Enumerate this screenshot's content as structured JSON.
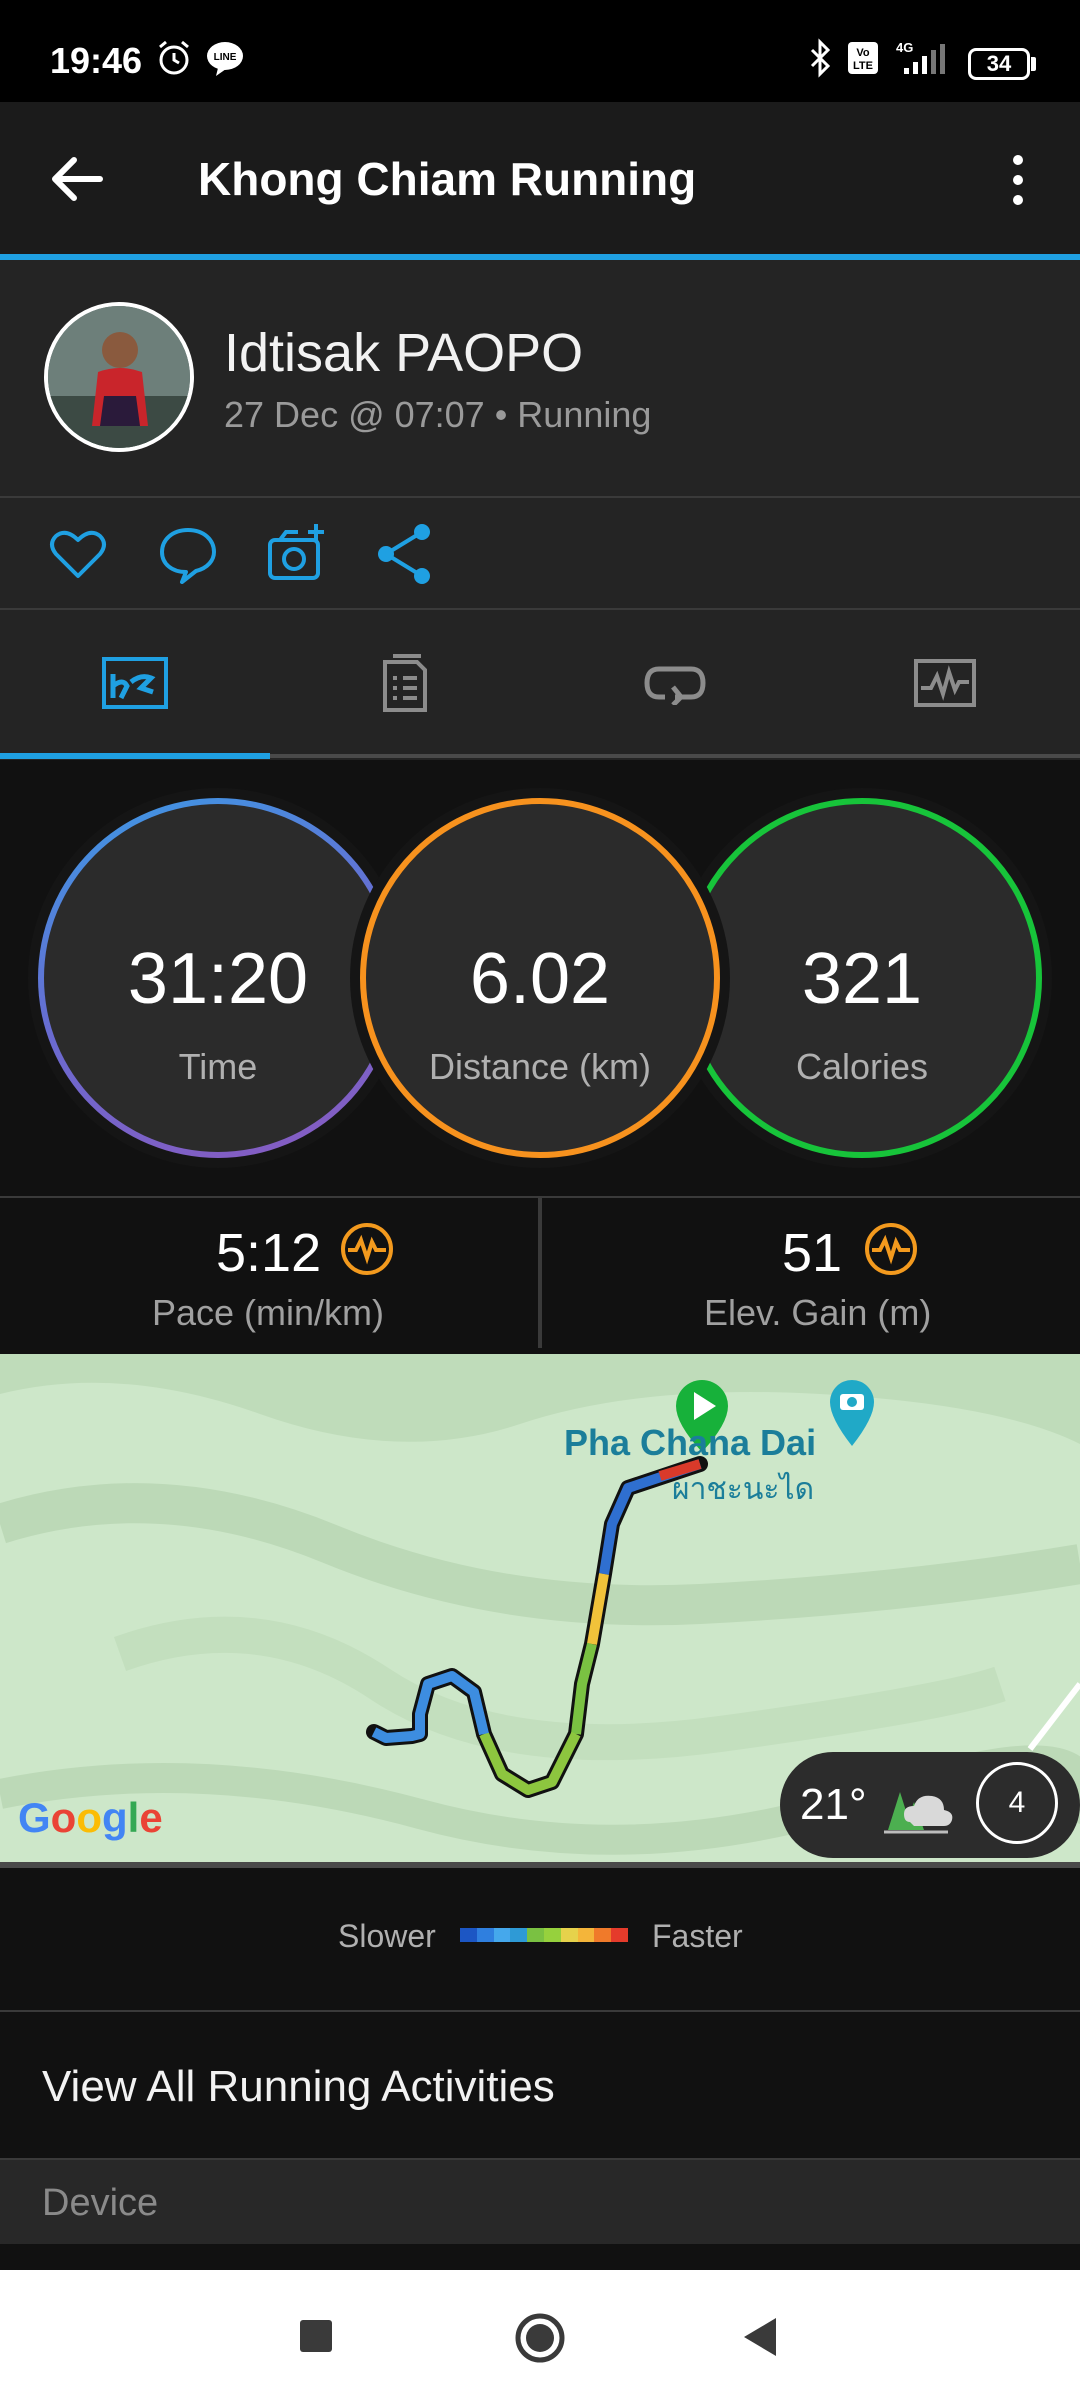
{
  "status_bar": {
    "time": "19:46",
    "battery": "34",
    "network": "4G",
    "icons": [
      "alarm-icon",
      "line-app-icon",
      "bluetooth-icon",
      "volte-icon",
      "signal-icon",
      "battery-icon"
    ]
  },
  "app_bar": {
    "title": "Khong Chiam Running",
    "icons": [
      "back-arrow-icon",
      "more-vert-icon"
    ]
  },
  "profile": {
    "name": "Idtisak PAOPO",
    "meta": "27 Dec @ 07:07 • Running"
  },
  "actions": [
    "like-icon",
    "comment-icon",
    "add-photo-icon",
    "share-icon"
  ],
  "tabs": [
    "overview-tab-icon",
    "details-tab-icon",
    "laps-tab-icon",
    "charts-tab-icon"
  ],
  "stats": {
    "time": {
      "value": "31:20",
      "label": "Time"
    },
    "distance": {
      "value": "6.02",
      "label": "Distance (km)"
    },
    "calories": {
      "value": "321",
      "label": "Calories"
    }
  },
  "metrics": {
    "pace": {
      "value": "5:12",
      "label": "Pace (min/km)"
    },
    "elevation": {
      "value": "51",
      "label": "Elev. Gain (m)"
    }
  },
  "map": {
    "poi_name": "Pha Chana Dai",
    "poi_thai": "ผาชะนะได",
    "provider": "Google",
    "weather_temp": "21°",
    "compass_value": "4"
  },
  "legend": {
    "slower": "Slower",
    "faster": "Faster",
    "colors": [
      "#1c56c4",
      "#2f7fdf",
      "#45a8ec",
      "#2e9ad6",
      "#7ac142",
      "#96d13d",
      "#e6d24b",
      "#f4b53a",
      "#f07a2a",
      "#e53b2b"
    ]
  },
  "links": {
    "view_all": "View All Running Activities"
  },
  "sections": {
    "device": "Device"
  },
  "colors": {
    "accent": "#1fa0e2",
    "time_ring": "#3b8fe0",
    "distance_ring": "#f7921e",
    "calories_ring": "#17c43a"
  }
}
